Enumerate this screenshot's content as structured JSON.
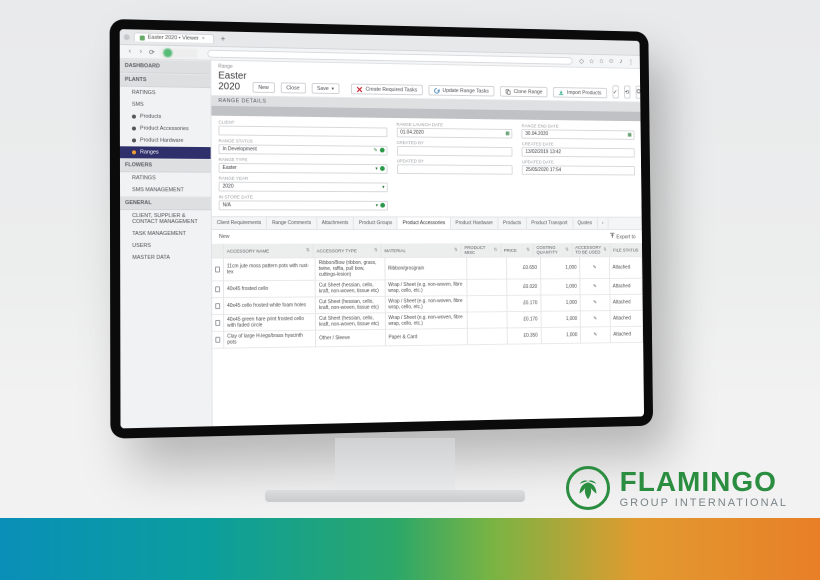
{
  "browser": {
    "tab_title": "Easter 2020 • Viewer",
    "new_tab_glyph": "+"
  },
  "header": {
    "crumb": "Range",
    "title": "Easter 2020",
    "buttons": {
      "new": "New",
      "close": "Close",
      "save": "Save",
      "create_required_tasks": "Create Required Tasks",
      "update_range_tasks": "Update Range Tasks",
      "clone_range": "Clone Range",
      "import_products": "Import Products"
    }
  },
  "sidebar": {
    "groups": [
      {
        "label": "DASHBOARD",
        "items": []
      },
      {
        "label": "PLANTS",
        "items": [
          {
            "label": "RATINGS"
          },
          {
            "label": "SMS",
            "children": [
              {
                "label": "Products"
              },
              {
                "label": "Product Accessories"
              },
              {
                "label": "Product Hardware"
              },
              {
                "label": "Ranges",
                "active": true
              }
            ]
          }
        ]
      },
      {
        "label": "FLOWERS",
        "items": [
          {
            "label": "RATINGS"
          },
          {
            "label": "SMS MANAGEMENT"
          }
        ]
      },
      {
        "label": "GENERAL",
        "items": [
          {
            "label": "CLIENT, SUPPLIER & CONTACT MANAGEMENT"
          },
          {
            "label": "TASK MANAGEMENT"
          },
          {
            "label": "USERS"
          },
          {
            "label": "MASTER DATA"
          }
        ]
      }
    ]
  },
  "section": {
    "title": "RANGE DETAILS"
  },
  "form": {
    "client": {
      "label": "CLIENT",
      "value": ""
    },
    "range_status": {
      "label": "RANGE STATUS",
      "value": "In Development"
    },
    "range_type": {
      "label": "RANGE TYPE",
      "value": "Easter"
    },
    "range_year": {
      "label": "RANGE YEAR",
      "value": "2020"
    },
    "in_store_date": {
      "label": "IN STORE DATE",
      "value": "N/A"
    },
    "range_launch_date": {
      "label": "RANGE LAUNCH DATE",
      "value": "01.04.2020"
    },
    "created_by": {
      "label": "CREATED BY",
      "value": ""
    },
    "updated_by": {
      "label": "UPDATED BY",
      "value": ""
    },
    "range_end_date": {
      "label": "RANGE END DATE",
      "value": "30.04.2020"
    },
    "created_date": {
      "label": "CREATED DATE",
      "value": "13/02/2019 13:42"
    },
    "updated_date": {
      "label": "UPDATED DATE",
      "value": "25/05/2020 17:54"
    }
  },
  "subtabs": [
    "Client Requirements",
    "Range Comments",
    "Attachments",
    "Product Groups",
    "Product Accessories",
    "Product Hardware",
    "Products",
    "Product Transport",
    "Quotes"
  ],
  "subtab_active_index": 4,
  "gridbar": {
    "new": "New",
    "export": "Export to"
  },
  "table": {
    "columns": [
      "",
      "ACCESSORY NAME",
      "ACCESSORY TYPE",
      "MATERIAL",
      "PRODUCT MISC",
      "PRICE",
      "COSTING QUANTITY",
      "ACCESSORY TO BE USED",
      "FILE STATUS"
    ],
    "rows": [
      {
        "name": "11cm jute moss pattern pots with rust-tex",
        "type": "Ribbon/Bow (ribbon, grass, twine, raffia, pull bow, cuttings-lesion)",
        "material": "Ribbon/grosgrain",
        "misc": "",
        "price": "£0.650",
        "qty": "1,000",
        "used": true,
        "status": "Attached"
      },
      {
        "name": "40x45 frosted cello",
        "type": "Cut Sheet (hessian, cello, kraft, non-woven, tissue etc)",
        "material": "Wrap / Sheet (e.g. non-woven, fibre wrap, cello, etc.)",
        "misc": "",
        "price": "£0.020",
        "qty": "1,000",
        "used": true,
        "status": "Attached"
      },
      {
        "name": "40x45 cello frosted white foam holes",
        "type": "Cut Sheet (hessian, cello, kraft, non-woven, tissue etc)",
        "material": "Wrap / Sheet (e.g. non-woven, fibre wrap, cello, etc.)",
        "misc": "",
        "price": "£0.170",
        "qty": "1,000",
        "used": true,
        "status": "Attached"
      },
      {
        "name": "40x45 green hare print frosted cello with faded circle",
        "type": "Cut Sheet (hessian, cello, kraft, non-woven, tissue etc)",
        "material": "Wrap / Sheet (e.g. non-woven, fibre wrap, cello, etc.)",
        "misc": "",
        "price": "£0.170",
        "qty": "1,000",
        "used": true,
        "status": "Attached"
      },
      {
        "name": "Clay of large H-legs/brass hyacinth pots",
        "type": "Other / Sleeve",
        "material": "Paper & Card",
        "misc": "",
        "price": "£0.350",
        "qty": "1,000",
        "used": true,
        "status": "Attached"
      }
    ]
  },
  "brand": {
    "name": "FLAMINGO",
    "sub": "GROUP INTERNATIONAL"
  }
}
